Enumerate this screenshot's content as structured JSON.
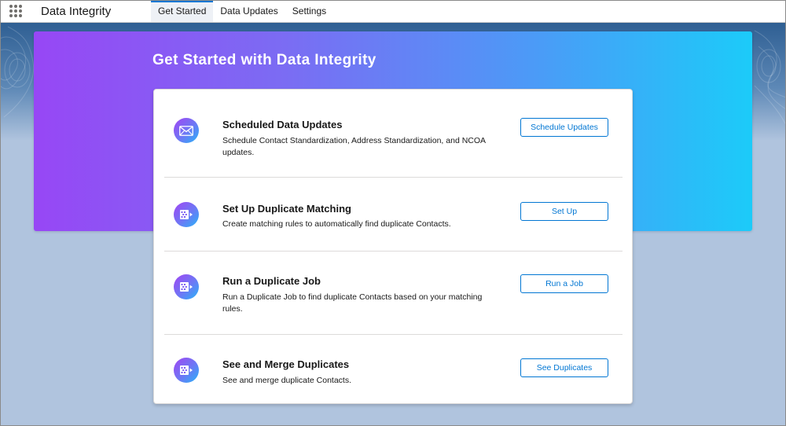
{
  "app": {
    "name": "Data Integrity"
  },
  "nav": {
    "tabs": [
      {
        "label": "Get Started",
        "active": true
      },
      {
        "label": "Data Updates",
        "active": false
      },
      {
        "label": "Settings",
        "active": false
      }
    ]
  },
  "hero": {
    "title": "Get Started with Data Integrity"
  },
  "colors": {
    "accent": "#0176d3",
    "hero_gradient_start": "#9747f5",
    "hero_gradient_end": "#1ccbf9",
    "background": "#b0c4de"
  },
  "sections": [
    {
      "icon": "envelope-icon",
      "title": "Scheduled Data Updates",
      "description": "Schedule Contact Standardization, Address Standardization, and NCOA updates.",
      "button": "Schedule Updates"
    },
    {
      "icon": "duplicate-record-icon",
      "title": "Set Up Duplicate Matching",
      "description": "Create matching rules to automatically find duplicate Contacts.",
      "button": "Set Up"
    },
    {
      "icon": "duplicate-record-icon",
      "title": "Run a Duplicate Job",
      "description": "Run a Duplicate Job to find duplicate Contacts based on your matching rules.",
      "button": "Run a Job"
    },
    {
      "icon": "duplicate-record-icon",
      "title": "See and Merge Duplicates",
      "description": "See and merge duplicate Contacts.",
      "button": "See Duplicates"
    }
  ]
}
